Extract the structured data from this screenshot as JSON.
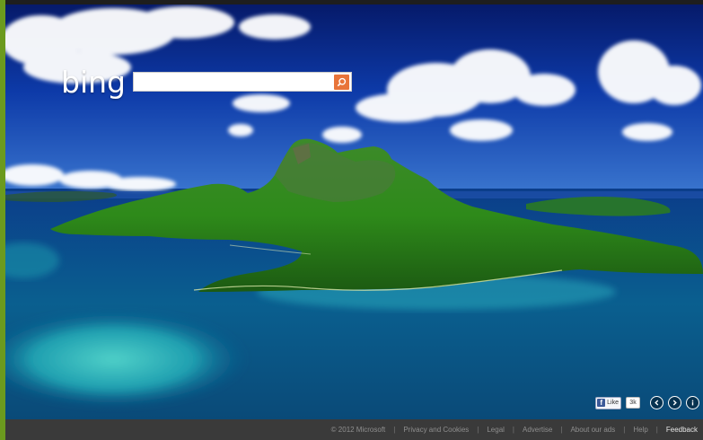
{
  "brand": {
    "logo_text": "bing",
    "accent_color": "#e8743a"
  },
  "search": {
    "value": "",
    "placeholder": "",
    "button_icon": "search-icon"
  },
  "background": {
    "subject": "tropical island aerial photo"
  },
  "social": {
    "like_label": "Like",
    "like_count": "3k"
  },
  "nav": {
    "prev_icon": "chevron-left-icon",
    "next_icon": "chevron-right-icon",
    "info_icon": "info-icon"
  },
  "footer": {
    "copyright": "© 2012 Microsoft",
    "links": [
      "Privacy and Cookies",
      "Legal",
      "Advertise",
      "About our ads",
      "Help",
      "Feedback"
    ]
  },
  "colors": {
    "frame_left": "#6b9a1e",
    "footer_bg": "#3a3a3a",
    "sky": "#0e2e8c",
    "ocean": "#0a5a86",
    "island": "#2f8a1f"
  }
}
